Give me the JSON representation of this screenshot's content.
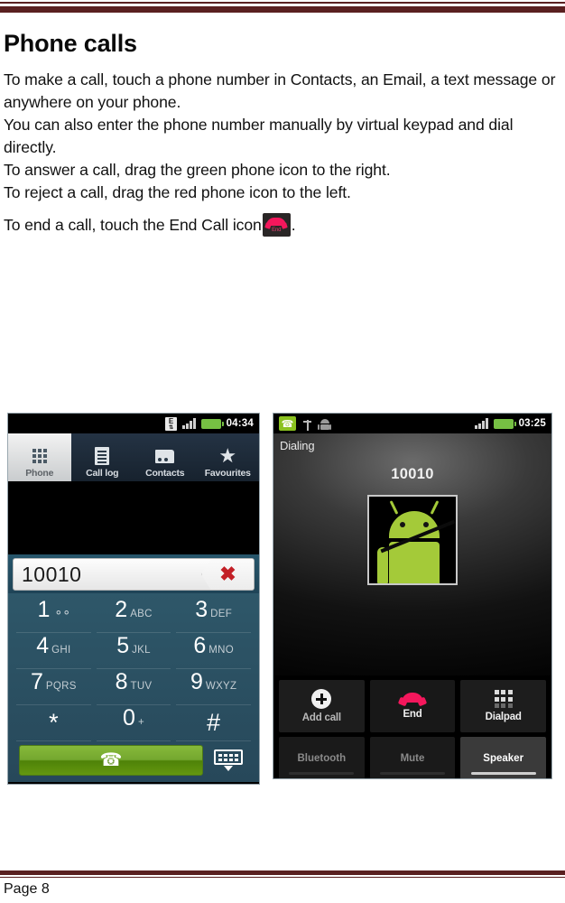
{
  "document": {
    "heading": "Phone calls",
    "paragraphs": [
      "To make a call, touch a phone number in Contacts, an Email, a text message or anywhere on your phone.",
      "You can also enter the phone number manually by virtual keypad and dial directly.",
      "To answer a call, drag the green phone icon to the right.",
      "To reject a call, drag the red phone icon to the left."
    ],
    "end_call_line_prefix": "To end a call, touch the End Call icon",
    "end_call_line_suffix": ".",
    "inline_icon_label": "End"
  },
  "footer": {
    "page_label": "Page 8"
  },
  "dialer_screenshot": {
    "status_bar": {
      "network_badge": "E",
      "network_arrows": "⇅",
      "time": "04:34"
    },
    "tabs": [
      {
        "label": "Phone",
        "icon": "dialpad-grid-icon",
        "active": true
      },
      {
        "label": "Call log",
        "icon": "document-lines-icon",
        "active": false
      },
      {
        "label": "Contacts",
        "icon": "contacts-card-icon",
        "active": false
      },
      {
        "label": "Favourites",
        "icon": "star-icon",
        "active": false
      }
    ],
    "number_field": {
      "value": "10010",
      "delete_icon": "red-x-icon"
    },
    "keypad": [
      {
        "digit": "1",
        "sub": "",
        "voicemail": true
      },
      {
        "digit": "2",
        "sub": "ABC"
      },
      {
        "digit": "3",
        "sub": "DEF"
      },
      {
        "digit": "4",
        "sub": "GHI"
      },
      {
        "digit": "5",
        "sub": "JKL"
      },
      {
        "digit": "6",
        "sub": "MNO"
      },
      {
        "digit": "7",
        "sub": "PQRS"
      },
      {
        "digit": "8",
        "sub": "TUV"
      },
      {
        "digit": "9",
        "sub": "WXYZ"
      },
      {
        "digit": "*",
        "sub": ""
      },
      {
        "digit": "0",
        "sub": "+"
      },
      {
        "digit": "#",
        "sub": ""
      }
    ],
    "call_button_icon": "green-handset-icon",
    "hide_keyboard_icon": "hide-keyboard-icon"
  },
  "incall_screenshot": {
    "status_bar": {
      "call_icon": "active-call-icon",
      "usb_icon": "usb-icon",
      "android_icon": "android-robot-icon",
      "time": "03:25"
    },
    "call_state": "Dialing",
    "number": "10010",
    "contact_photo": "android-mascot-photo",
    "primary_buttons": [
      {
        "label": "Add call",
        "icon": "plus-circle-icon"
      },
      {
        "label": "End",
        "icon": "end-call-handset-icon"
      },
      {
        "label": "Dialpad",
        "icon": "dialpad-grid-icon"
      }
    ],
    "toggle_buttons": [
      {
        "label": "Bluetooth",
        "on": false
      },
      {
        "label": "Mute",
        "on": false
      },
      {
        "label": "Speaker",
        "on": true
      }
    ]
  },
  "colors": {
    "rule": "#5a2020",
    "accent_green": "#8bc220",
    "accent_red": "#f4175c",
    "tab_bar": "#1c2b3a",
    "keypad": "#2e5769"
  }
}
